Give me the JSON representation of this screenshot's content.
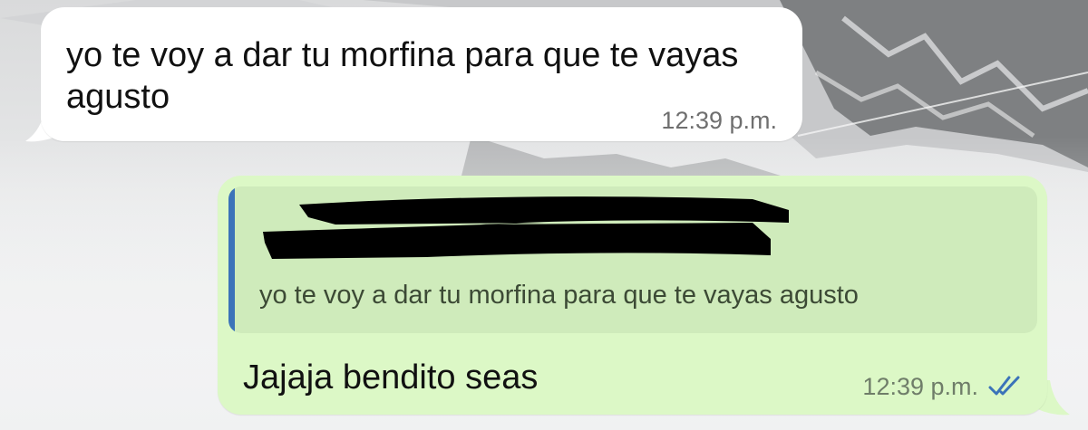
{
  "conversation": {
    "incoming_message": {
      "text": "yo te voy a dar tu morfina para que te vayas agusto",
      "time": "12:39 p.m."
    },
    "outgoing_message": {
      "quoted": {
        "sender": "",
        "text": "yo te voy a dar tu morfina para que te vayas agusto"
      },
      "text": "Jajaja bendito seas",
      "time": "12:39 p.m.",
      "status_icon": "double-check-read-icon"
    }
  },
  "colors": {
    "incoming_bubble": "#ffffff",
    "outgoing_bubble": "#dcf8c6",
    "quote_background": "#cfebbb",
    "quote_bar": "#3b73b9",
    "read_ticks": "#3b73b9",
    "timestamp": "#6f6f6f"
  }
}
